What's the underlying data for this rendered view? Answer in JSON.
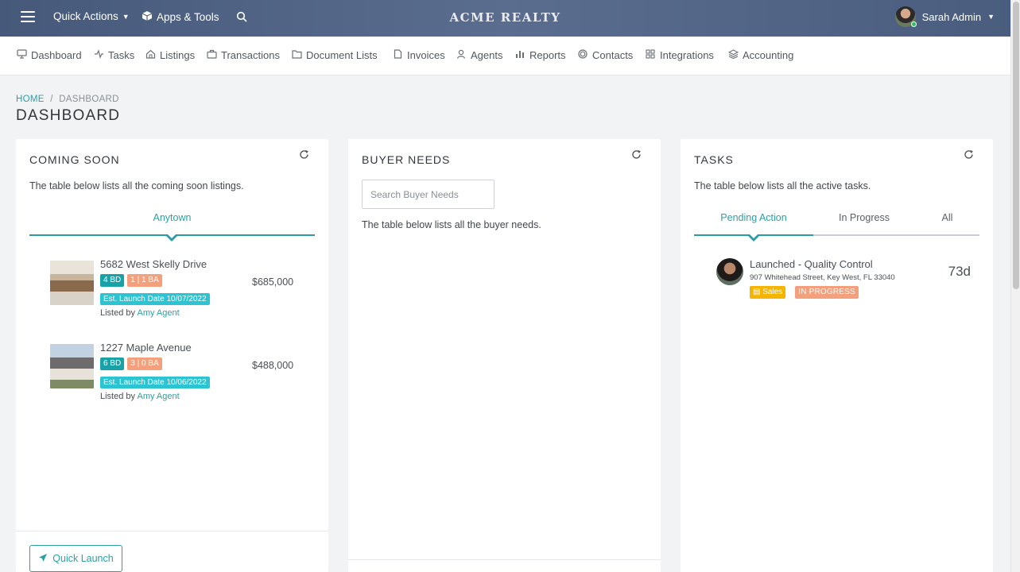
{
  "topbar": {
    "quick_actions": "Quick Actions",
    "apps_tools": "Apps & Tools",
    "brand": "ACME REALTY",
    "user_name": "Sarah Admin"
  },
  "nav": {
    "items": [
      {
        "label": "Dashboard",
        "icon": "monitor-icon"
      },
      {
        "label": "Tasks",
        "icon": "activity-icon"
      },
      {
        "label": "Listings",
        "icon": "home-icon"
      },
      {
        "label": "Transactions",
        "icon": "briefcase-icon"
      },
      {
        "label": "Document Lists",
        "icon": "folder-icon"
      },
      {
        "label": "Invoices",
        "icon": "file-icon"
      },
      {
        "label": "Agents",
        "icon": "user-icon"
      },
      {
        "label": "Reports",
        "icon": "bar-chart-icon"
      },
      {
        "label": "Contacts",
        "icon": "disc-icon"
      },
      {
        "label": "Integrations",
        "icon": "grid-icon"
      },
      {
        "label": "Accounting",
        "icon": "layers-icon"
      }
    ]
  },
  "breadcrumb": {
    "home": "HOME",
    "separator": "/",
    "current": "DASHBOARD"
  },
  "page_title": "DASHBOARD",
  "coming_soon": {
    "title": "COMING SOON",
    "description": "The table below lists all the coming soon listings.",
    "tab": "Anytown",
    "listings": [
      {
        "address": "5682 West Skelly Drive",
        "beds": "4 BD",
        "baths": "1 | 1 BA",
        "launch": "Est. Launch Date 10/07/2022",
        "price": "$685,000",
        "listed_by": "Listed by",
        "agent": "Amy Agent"
      },
      {
        "address": "1227 Maple Avenue",
        "beds": "6 BD",
        "baths": "3 | 0 BA",
        "launch": "Est. Launch Date 10/06/2022",
        "price": "$488,000",
        "listed_by": "Listed by",
        "agent": "Amy Agent"
      }
    ],
    "quick_launch": "Quick Launch"
  },
  "buyer_needs": {
    "title": "BUYER NEEDS",
    "search_placeholder": "Search Buyer Needs",
    "description": "The table below lists all the buyer needs."
  },
  "tasks": {
    "title": "TASKS",
    "description": "The table below lists all the active tasks.",
    "tabs": [
      "Pending Action",
      "In Progress",
      "All"
    ],
    "items": [
      {
        "title": "Launched - Quality Control",
        "address": "907 Whitehead Street, Key West, FL 33040",
        "tag": "Sales",
        "status": "IN PROGRESS",
        "days": "73d"
      }
    ]
  },
  "colors": {
    "accent": "#2aa1a6",
    "topbar": "#4f6284",
    "beds_badge": "#18a2a8",
    "baths_badge": "#f4a07c",
    "launch_badge": "#2cc3d3",
    "sales_badge": "#f5b400"
  }
}
